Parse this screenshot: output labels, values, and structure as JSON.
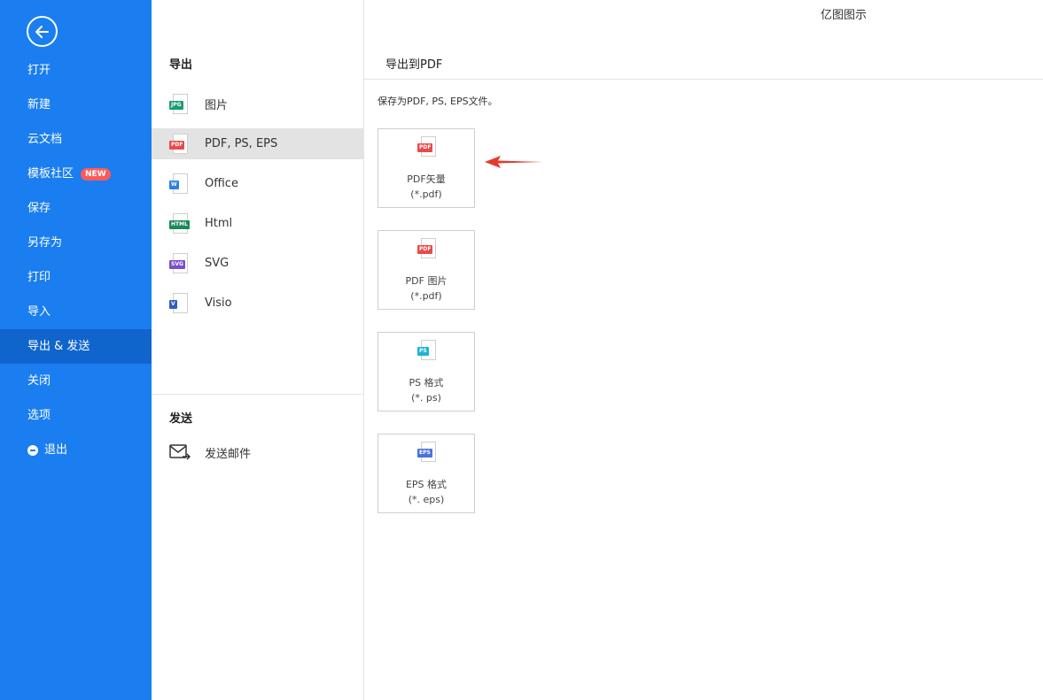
{
  "app_title": "亿图图示",
  "sidebar": {
    "items": [
      {
        "label": "打开"
      },
      {
        "label": "新建"
      },
      {
        "label": "云文档"
      },
      {
        "label": "模板社区",
        "badge": "NEW"
      },
      {
        "label": "保存"
      },
      {
        "label": "另存为"
      },
      {
        "label": "打印"
      },
      {
        "label": "导入"
      },
      {
        "label": "导出 & 发送",
        "active": true
      },
      {
        "label": "关闭"
      },
      {
        "label": "选项"
      },
      {
        "label": "退出"
      }
    ]
  },
  "export_panel": {
    "header": "导出",
    "items": [
      {
        "label": "图片",
        "icon_tag": "JPG",
        "icon_color": "#1a9e6e"
      },
      {
        "label": "PDF, PS, EPS",
        "icon_tag": "PDF",
        "icon_color": "#e94b4b"
      },
      {
        "label": "Office",
        "icon_tag": "W",
        "icon_color": "#2f7fe6"
      },
      {
        "label": "Html",
        "icon_tag": "HTML",
        "icon_color": "#1a8a5a"
      },
      {
        "label": "SVG",
        "icon_tag": "SVG",
        "icon_color": "#7a4fc9"
      },
      {
        "label": "Visio",
        "icon_tag": "V",
        "icon_color": "#2f5fc6"
      }
    ],
    "send_header": "发送",
    "send_item": "发送邮件"
  },
  "right_panel": {
    "header": "导出到PDF",
    "description": "保存为PDF, PS, EPS文件。",
    "cards": [
      {
        "line1": "PDF矢量",
        "line2": "(*.pdf)",
        "icon_tag": "PDF",
        "icon_color": "#e94b4b"
      },
      {
        "line1": "PDF 图片",
        "line2": "(*.pdf)",
        "icon_tag": "PDF",
        "icon_color": "#e94b4b"
      },
      {
        "line1": "PS 格式",
        "line2": "(*. ps)",
        "icon_tag": "PS",
        "icon_color": "#1fb3d6"
      },
      {
        "line1": "EPS 格式",
        "line2": "(*. eps)",
        "icon_tag": "EPS",
        "icon_color": "#4a72d9"
      }
    ]
  },
  "colors": {
    "sidebar_bg": "#1a7ef0",
    "sidebar_active": "#1065cc",
    "arrow": "#e63a2e"
  }
}
